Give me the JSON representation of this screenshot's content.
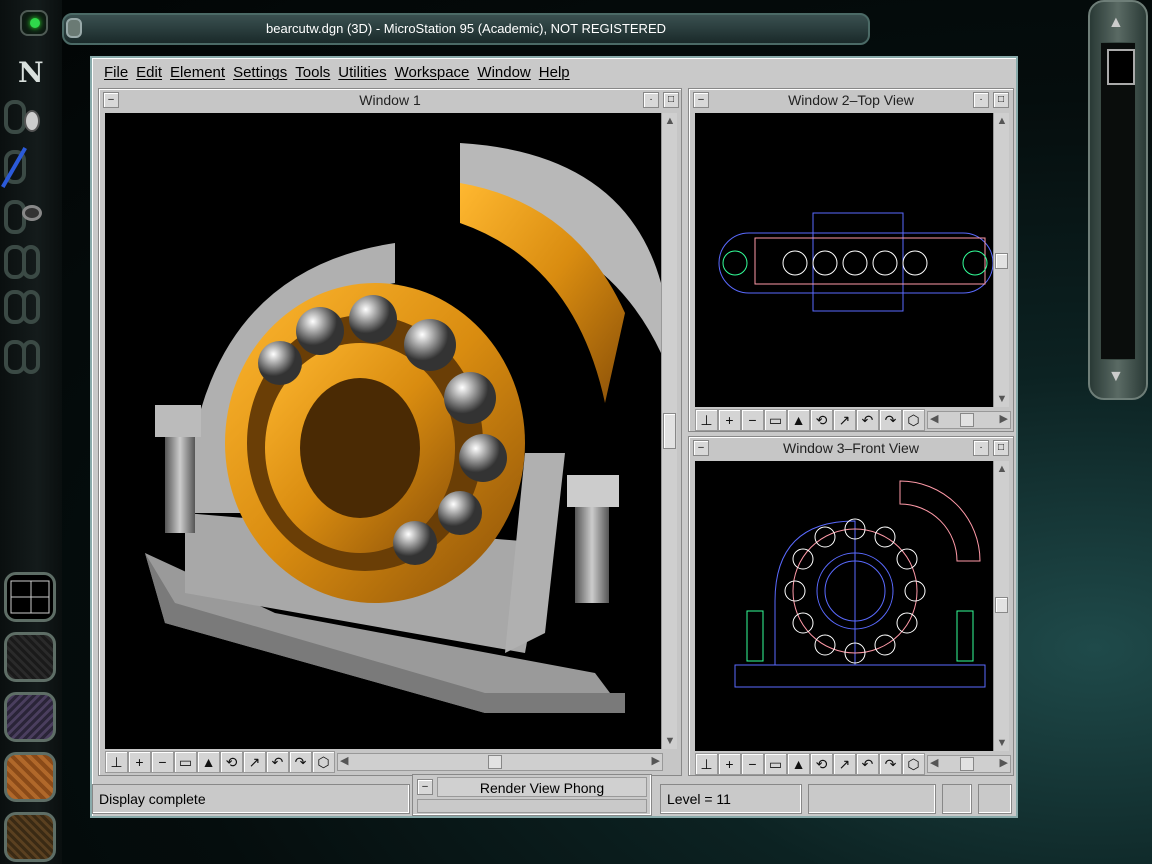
{
  "titlebar": {
    "title": "bearcutw.dgn (3D) - MicroStation 95 (Academic), NOT REGISTERED"
  },
  "menu": [
    "File",
    "Edit",
    "Element",
    "Settings",
    "Tools",
    "Utilities",
    "Workspace",
    "Window",
    "Help"
  ],
  "windows": {
    "w1": {
      "title": "Window 1"
    },
    "w2": {
      "title": "Window 2–Top View"
    },
    "w3": {
      "title": "Window 3–Front View"
    }
  },
  "view_tools": [
    "fit-view-icon",
    "zoom-in-icon",
    "zoom-out-icon",
    "window-area-icon",
    "render-icon",
    "rotate-view-icon",
    "pan-icon",
    "view-previous-icon",
    "view-next-icon",
    "view-cube-icon"
  ],
  "status": {
    "message": "Display complete",
    "render_label": "Render View Phong",
    "level": "Level = 11"
  },
  "dock": {
    "letter": "N"
  },
  "colors": {
    "accent": "#2fd94b",
    "gold": "#d98c10",
    "wire_blue": "#5a6aff",
    "wire_pink": "#ff9aa8"
  }
}
